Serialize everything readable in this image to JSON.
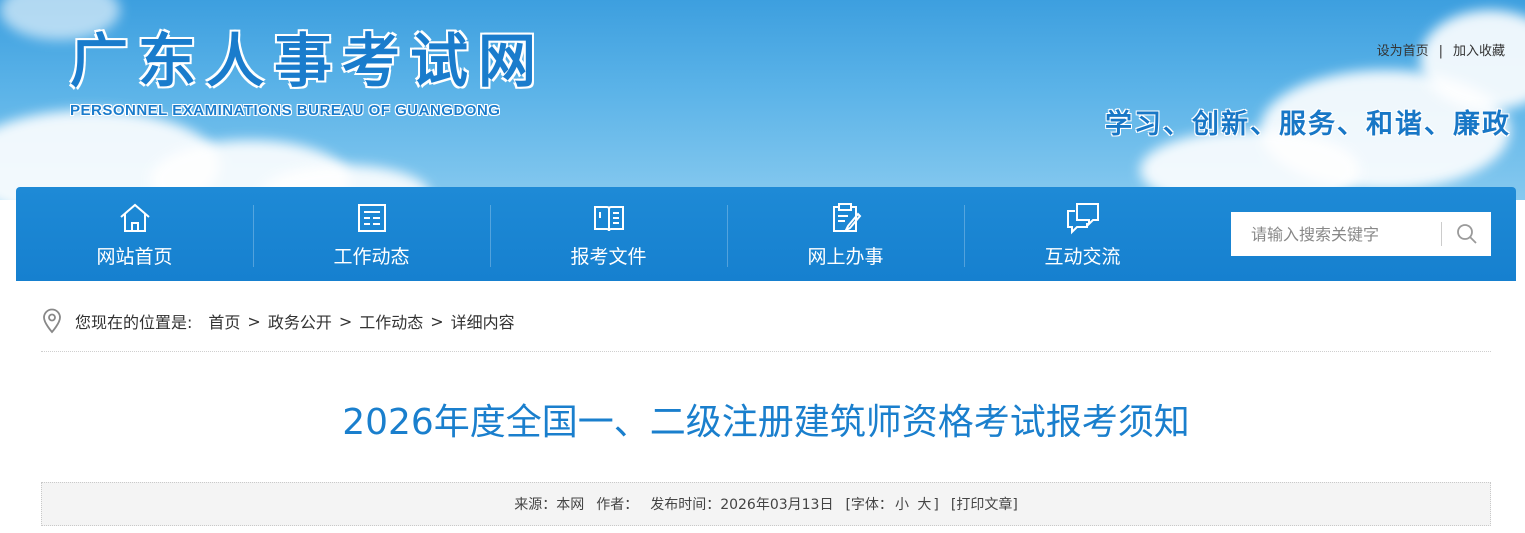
{
  "header": {
    "logo_cn": "广东人事考试网",
    "logo_en": "PERSONNEL EXAMINATIONS BUREAU OF GUANGDONG",
    "set_home": "设为首页",
    "sep": "|",
    "add_fav": "加入收藏",
    "slogan": "学习、创新、服务、和谐、廉政"
  },
  "nav": {
    "items": [
      {
        "label": "网站首页",
        "icon": "home-icon"
      },
      {
        "label": "工作动态",
        "icon": "news-icon"
      },
      {
        "label": "报考文件",
        "icon": "book-icon"
      },
      {
        "label": "网上办事",
        "icon": "clipboard-pen-icon"
      },
      {
        "label": "互动交流",
        "icon": "chat-bubbles-icon"
      }
    ],
    "search_placeholder": "请输入搜索关键字"
  },
  "breadcrumb": {
    "lead": "您现在的位置是:",
    "items": [
      "首页",
      "政务公开",
      "工作动态",
      "详细内容"
    ],
    "sep": ">"
  },
  "article": {
    "title": "2026年度全国一、二级注册建筑师资格考试报考须知",
    "source": "来源：本网",
    "author": "作者：",
    "published": "发布时间：2026年03月13日",
    "font_label": "[字体：",
    "font_small": "小",
    "font_large": "大",
    "font_close": "]",
    "print": "[打印文章]"
  },
  "colors": {
    "nav_bg": "#1680cf",
    "title": "#1a7fcd",
    "logo": "#1a7ccc"
  }
}
